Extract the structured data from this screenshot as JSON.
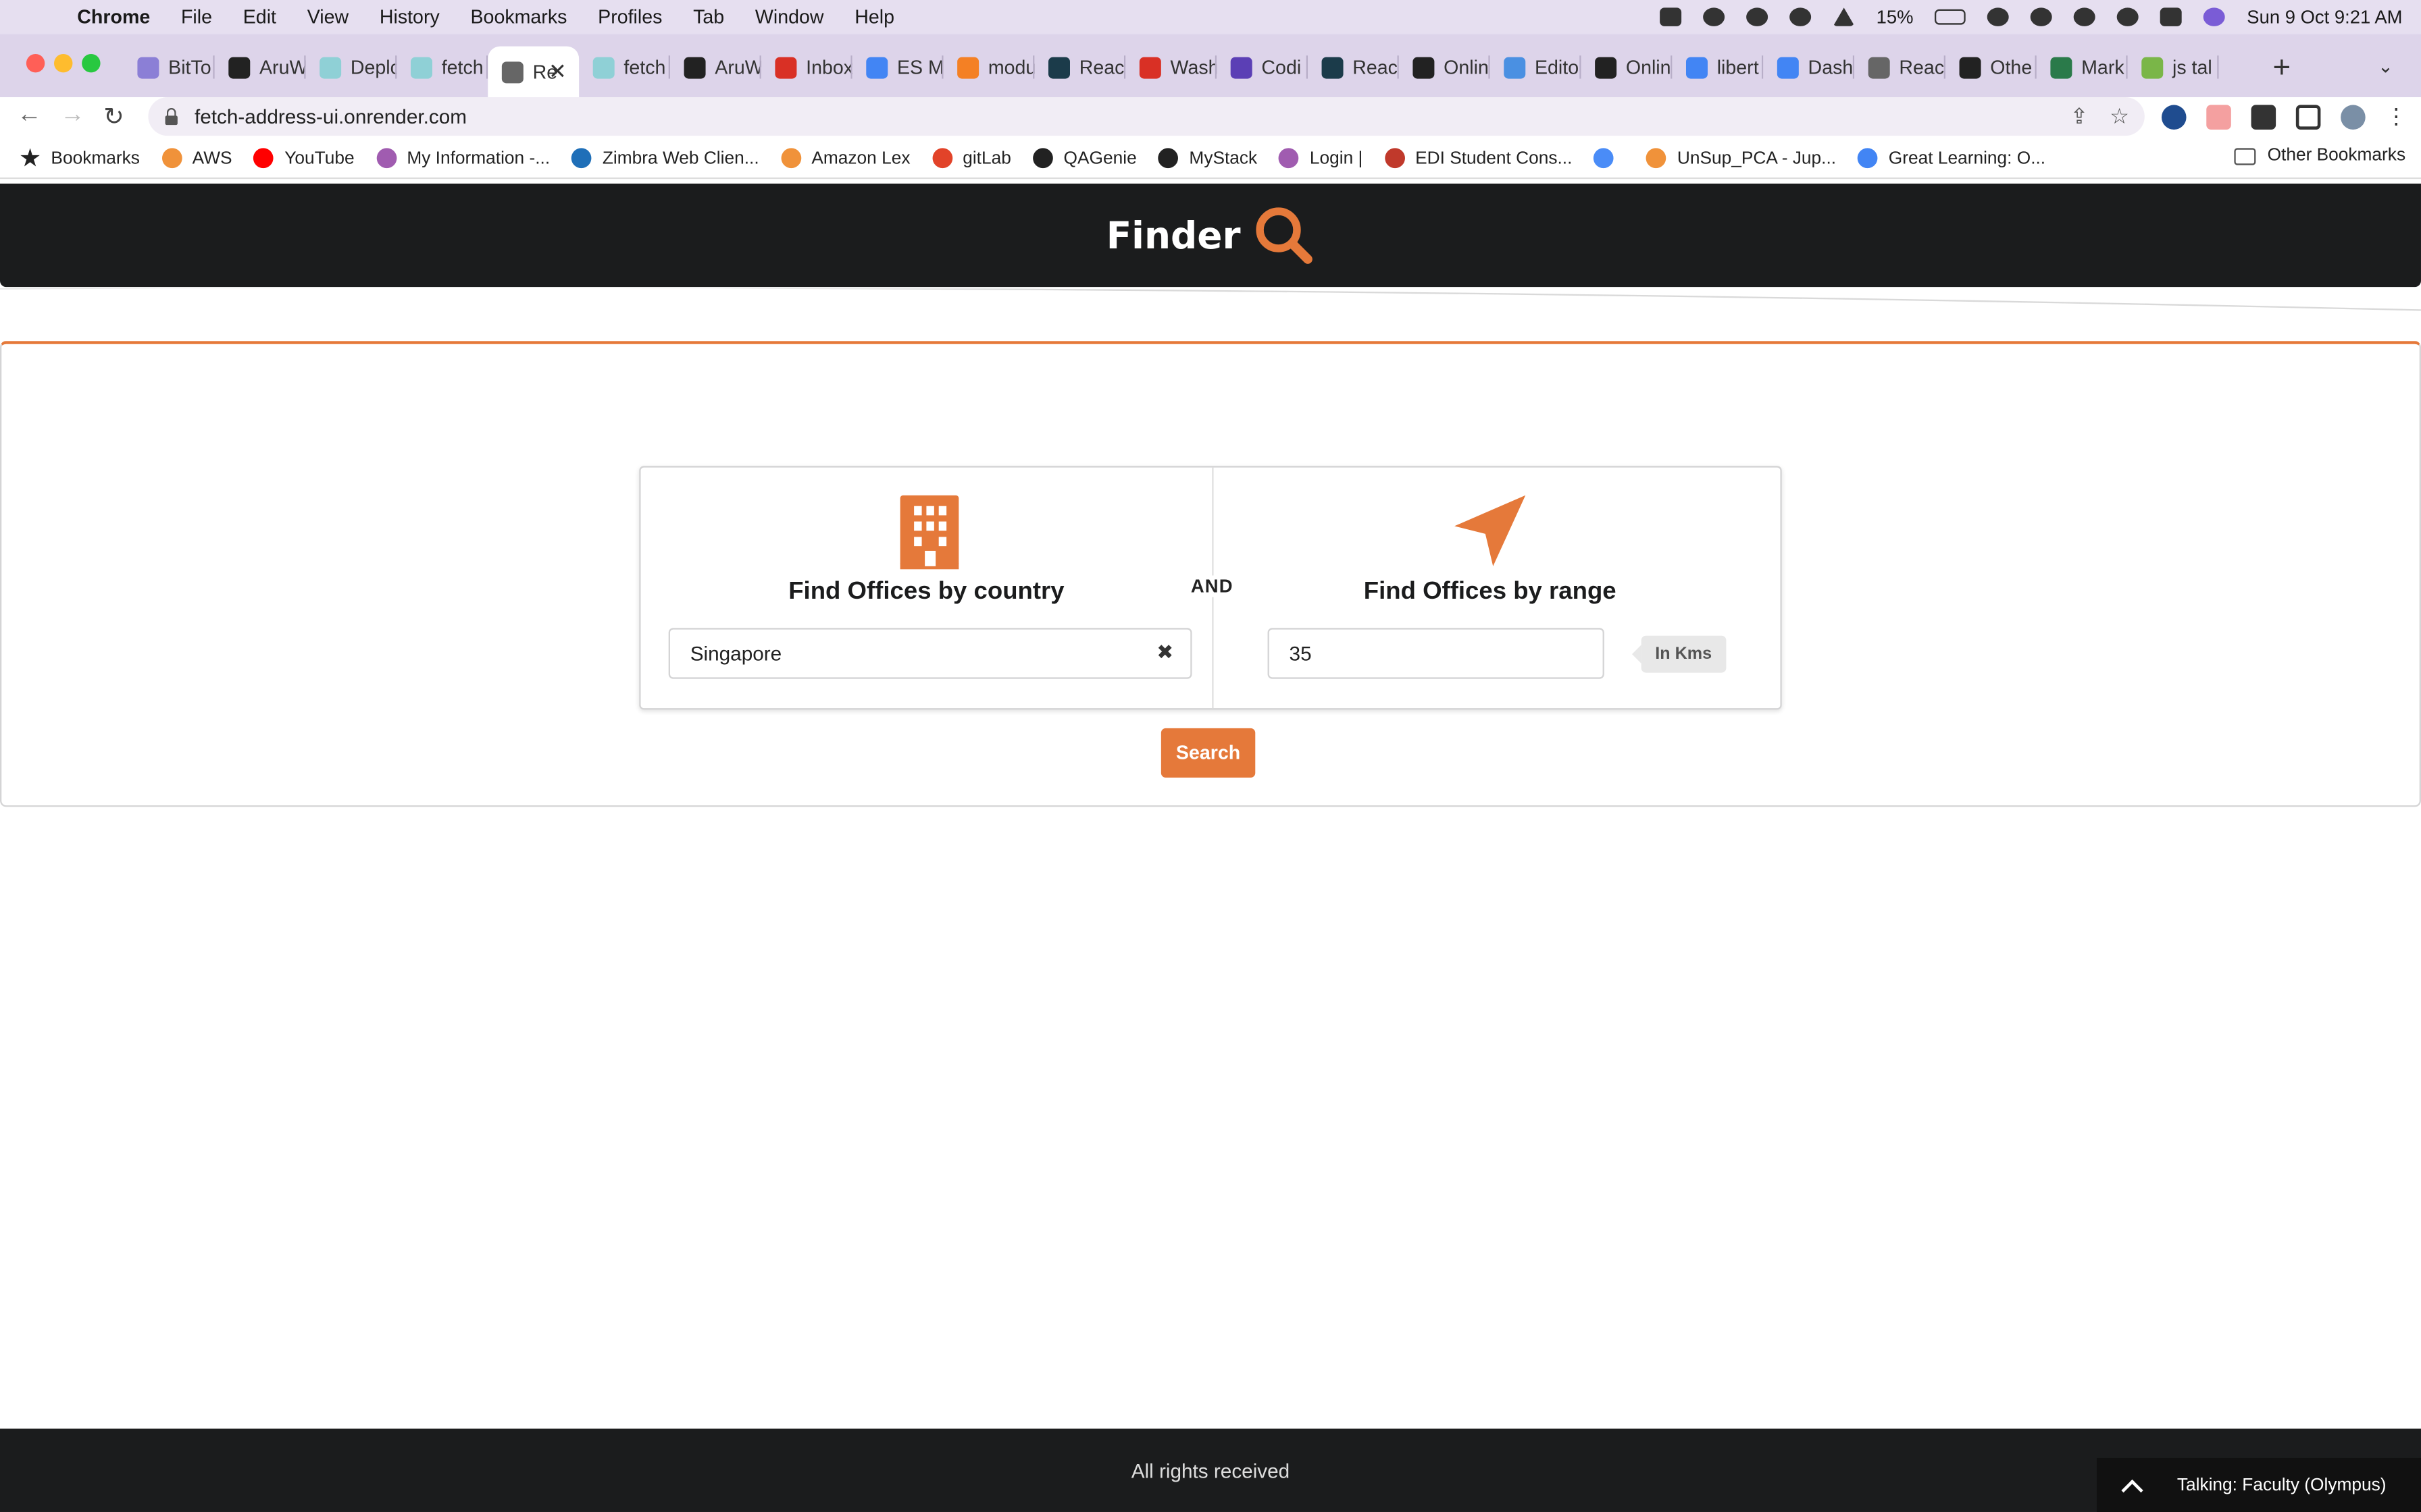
{
  "menubar": {
    "items": [
      "Chrome",
      "File",
      "Edit",
      "View",
      "History",
      "Bookmarks",
      "Profiles",
      "Tab",
      "Window",
      "Help"
    ],
    "battery": "15%",
    "datetime": "Sun 9 Oct  9:21 AM"
  },
  "tabs": [
    {
      "label": "BitTo",
      "color": "#8b7fd6"
    },
    {
      "label": "AruW",
      "color": "#222222"
    },
    {
      "label": "Deplo",
      "color": "#8fd0d6"
    },
    {
      "label": "fetch",
      "color": "#8fd0d6"
    },
    {
      "label": "Re",
      "color": "#666666",
      "active": true
    },
    {
      "label": "fetch",
      "color": "#8fd0d6"
    },
    {
      "label": "AruW",
      "color": "#222222"
    },
    {
      "label": "Inbox",
      "color": "#d93025"
    },
    {
      "label": "ES M",
      "color": "#4285f4"
    },
    {
      "label": "modu",
      "color": "#f48024"
    },
    {
      "label": "Reac",
      "color": "#1b3b4a"
    },
    {
      "label": "Wash",
      "color": "#d93025"
    },
    {
      "label": "Codi",
      "color": "#5b3fb5"
    },
    {
      "label": "Reac",
      "color": "#1b3b4a"
    },
    {
      "label": "Onlin",
      "color": "#222222"
    },
    {
      "label": "Edito",
      "color": "#4a90e2"
    },
    {
      "label": "Onlin",
      "color": "#222222"
    },
    {
      "label": "libert",
      "color": "#4285f4"
    },
    {
      "label": "Dash",
      "color": "#4285f4"
    },
    {
      "label": "Reac",
      "color": "#666666"
    },
    {
      "label": "Othe",
      "color": "#222222"
    },
    {
      "label": "Mark",
      "color": "#2a7a4a"
    },
    {
      "label": "js tal",
      "color": "#7ab648"
    }
  ],
  "toolbar": {
    "url": "fetch-address-ui.onrender.com"
  },
  "bookmarks": {
    "items": [
      {
        "label": "Bookmarks",
        "color": "#222222"
      },
      {
        "label": "AWS",
        "color": "#f0923a"
      },
      {
        "label": "YouTube",
        "color": "#ff0000"
      },
      {
        "label": "My Information -...",
        "color": "#a05cb0"
      },
      {
        "label": "Zimbra Web Clien...",
        "color": "#1f6fb8"
      },
      {
        "label": "Amazon Lex",
        "color": "#f0923a"
      },
      {
        "label": "gitLab",
        "color": "#e24329"
      },
      {
        "label": "QAGenie",
        "color": "#222222"
      },
      {
        "label": "MyStack",
        "color": "#222222"
      },
      {
        "label": "Login |",
        "color": "#a05cb0"
      },
      {
        "label": "EDI Student Cons...",
        "color": "#c0392b"
      },
      {
        "label": "",
        "color": "#4a8cf7"
      },
      {
        "label": "UnSup_PCA - Jup...",
        "color": "#f0923a"
      },
      {
        "label": "Great Learning: O...",
        "color": "#4285f4"
      }
    ],
    "other": "Other Bookmarks"
  },
  "app": {
    "brand": "Finder",
    "and_label": "AND",
    "country": {
      "title": "Find Offices by country",
      "value": "Singapore"
    },
    "range": {
      "title": "Find Offices by range",
      "value": "35",
      "unit": "In Kms"
    },
    "search_label": "Search",
    "footer": "All rights received",
    "talking": "Talking: Faculty (Olympus)",
    "accent": "#e5793a",
    "dark": "#1b1c1d"
  }
}
